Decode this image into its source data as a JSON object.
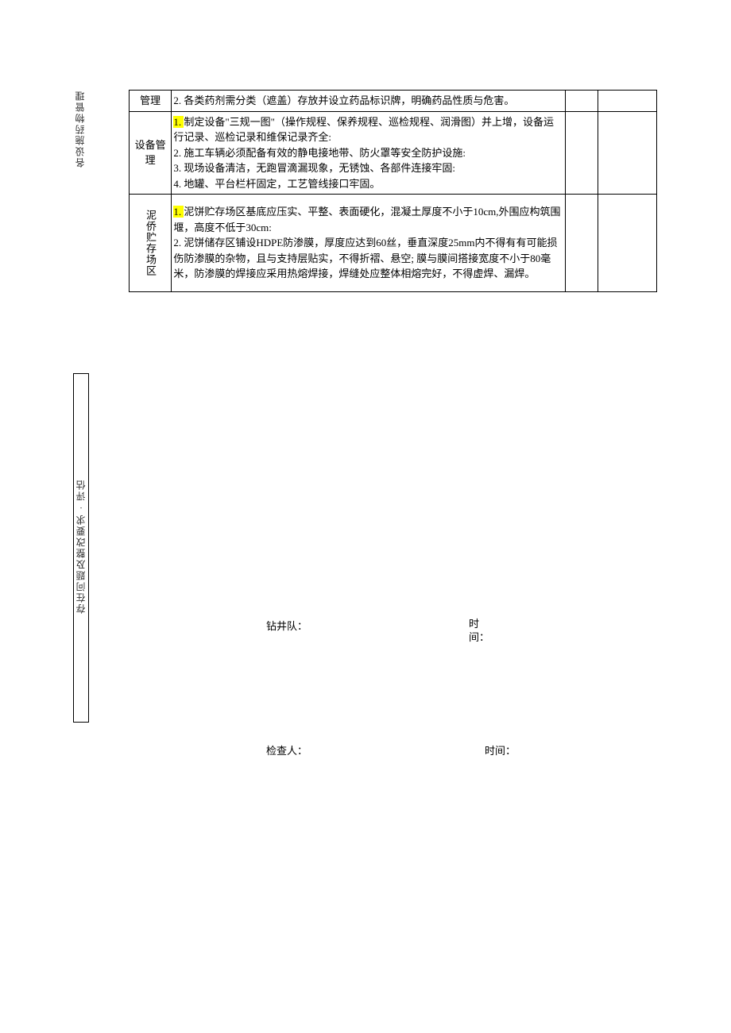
{
  "sideLabel1": "各设施药物管理",
  "sideLabel2": "存在问题及整改要求·评估",
  "table": {
    "row1": {
      "sub": "管理",
      "content": "2. 各类药剂需分类（遮盖）存放并设立药品标识牌，明确药品性质与危害。"
    },
    "row2": {
      "sub": "设备管理",
      "hl": "1. ",
      "content_after_hl": "制定设备\"三规一图\"（操作规程、保养规程、巡检规程、润滑图）并上增，设备运行记录、巡检记录和维保记录齐全:",
      "line2": "2. 施工车辆必须配备有效的静电接地带、防火罩等安全防护设施:",
      "line3": "3. 现场设备清洁，无跑冒滴漏现象，无锈蚀、各部件连接牢固:",
      "line4": "4. 地罐、平台栏杆固定，工艺管线接口牢固。"
    },
    "row3": {
      "cat": "泥侨贮存场区",
      "hl": "1. ",
      "content_after_hl": "泥饼贮存场区基底应压实、平整、表面硬化，混凝土厚度不小于10cm,外围应构筑围堰，高度不低于30cm:",
      "line2": "2. 泥饼储存区铺设HDPE防渗膜，厚度应达到60丝，垂直深度25mm内不得有有可能损伤防渗膜的杂物，且与支持层贴实，不得折褶、悬空; 膜与膜间搭接宽度不小于80毫米，防渗膜的焊接应采用热熔焊接，焊缝处应整体相熔完好，不得虚焊、漏焊。"
    }
  },
  "signatures": {
    "team_label": "钻井队：",
    "time_label_1": "时间：",
    "inspector_label": "检查人：",
    "time_label_2": "时间："
  }
}
